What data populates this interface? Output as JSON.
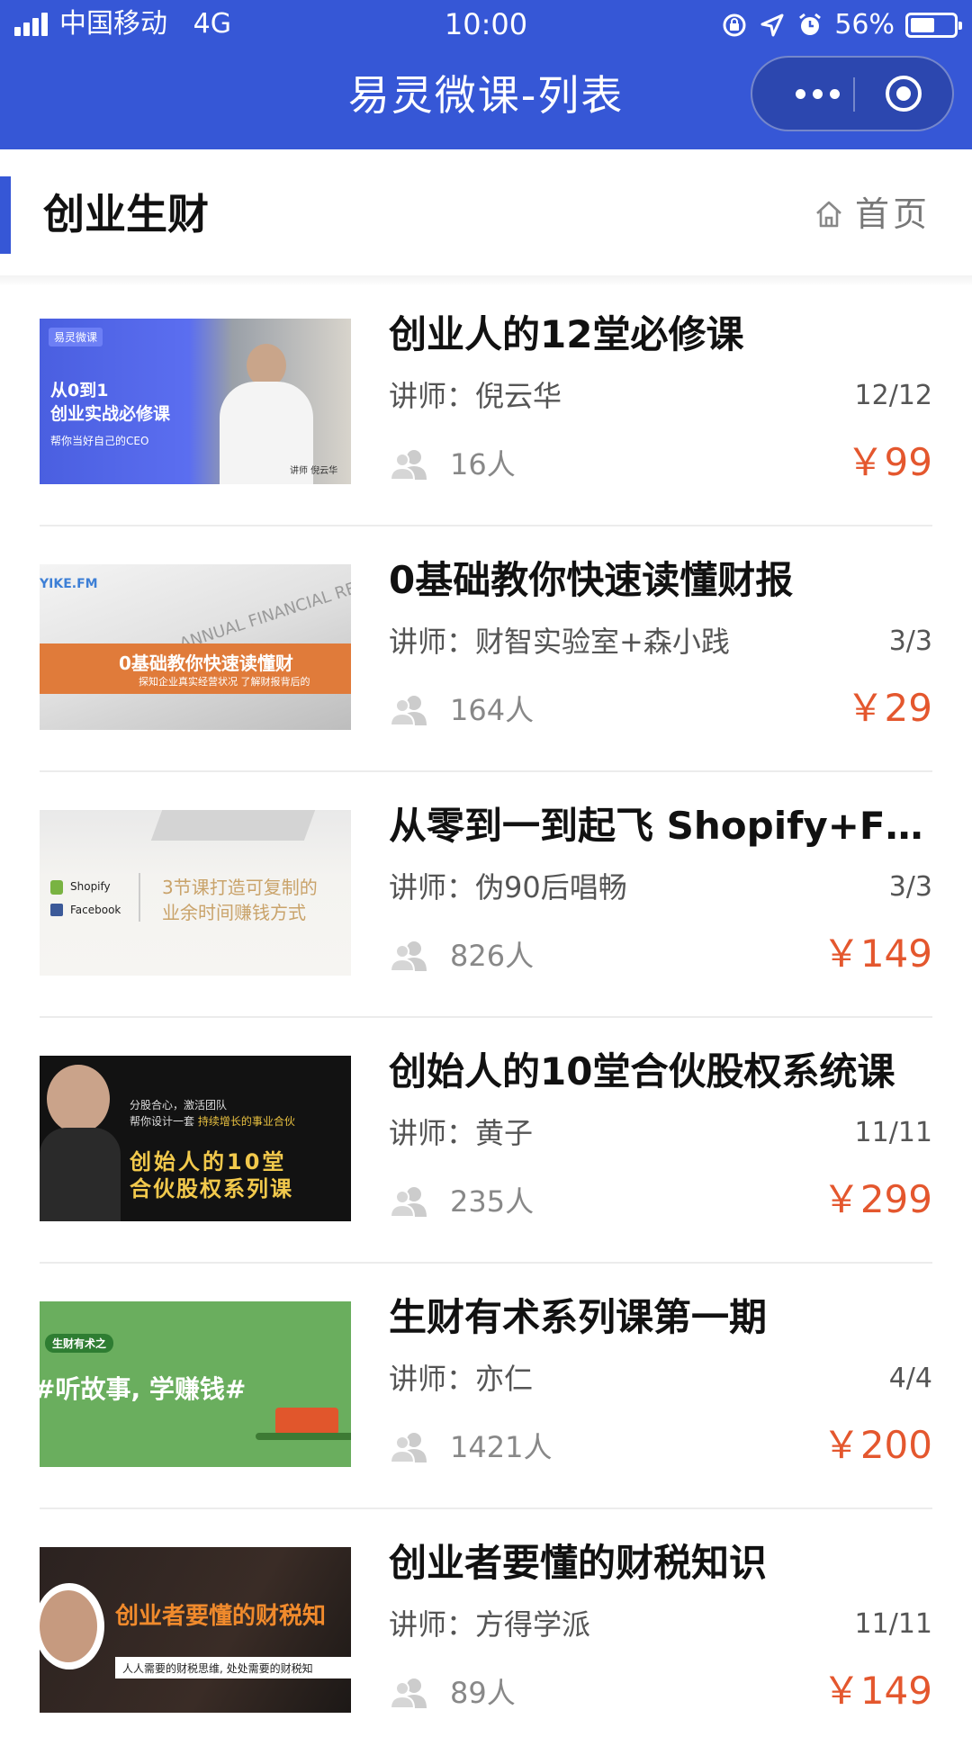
{
  "status_bar": {
    "carrier": "中国移动",
    "network": "4G",
    "time": "10:00",
    "battery": "56%",
    "battery_level": 0.56
  },
  "nav": {
    "title": "易灵微课-列表",
    "more_icon": "more-dots-icon",
    "close_icon": "target-circle-icon"
  },
  "category": {
    "title": "创业生财",
    "home_label": "首页",
    "home_icon": "home-icon"
  },
  "colors": {
    "brand_blue": "#3657d6",
    "price_red": "#e4572e"
  },
  "courses": [
    {
      "title": "创业人的12堂必修课",
      "teacher": "讲师：倪云华",
      "progress": "12/12",
      "learners": "16人",
      "price": "￥99",
      "thumb": {
        "brand": "易灵微课",
        "line1": "从0到1",
        "line2": "创业实战必修课",
        "line3": "帮你当好自己的CEO",
        "caption": "讲师 倪云华"
      }
    },
    {
      "title": "0基础教你快速读懂财报",
      "teacher": "讲师：财智实验室+森小践",
      "progress": "3/3",
      "learners": "164人",
      "price": "￥29",
      "thumb": {
        "brand": "YIKE.FM",
        "bg_text": "ANNUAL FINANCIAL REPORT",
        "line1": "0基础教你快速读懂财",
        "line2": "探知企业真实经营状况  了解财报背后的"
      }
    },
    {
      "title": "从零到一到起飞 Shopify+F…",
      "teacher": "讲师：伪90后唱畅",
      "progress": "3/3",
      "learners": "826人",
      "price": "￥149",
      "thumb": {
        "brand1": "Shopify",
        "brand2": "Facebook",
        "line1": "3节课打造可复制的",
        "line2": "业余时间赚钱方式"
      }
    },
    {
      "title": "创始人的10堂合伙股权系统课",
      "teacher": "讲师：黄子",
      "progress": "11/11",
      "learners": "235人",
      "price": "￥299",
      "thumb": {
        "line1": "分股合心，激活团队",
        "line2": "帮你设计一套",
        "line2b": "持续增长的事业合伙",
        "line3": "创始人的10堂",
        "line4": "合伙股权系列课"
      }
    },
    {
      "title": "生财有术系列课第一期",
      "teacher": "讲师：亦仁",
      "progress": "4/4",
      "learners": "1421人",
      "price": "￥200",
      "thumb": {
        "tag": "生财有术之",
        "line1": "#听故事, 学赚钱#"
      }
    },
    {
      "title": "创业者要懂的财税知识",
      "teacher": "讲师：方得学派",
      "progress": "11/11",
      "learners": "89人",
      "price": "￥149",
      "thumb": {
        "line1": "创业者要懂的财税知",
        "line2": "人人需要的财税思维, 处处需要的财税知"
      }
    }
  ]
}
